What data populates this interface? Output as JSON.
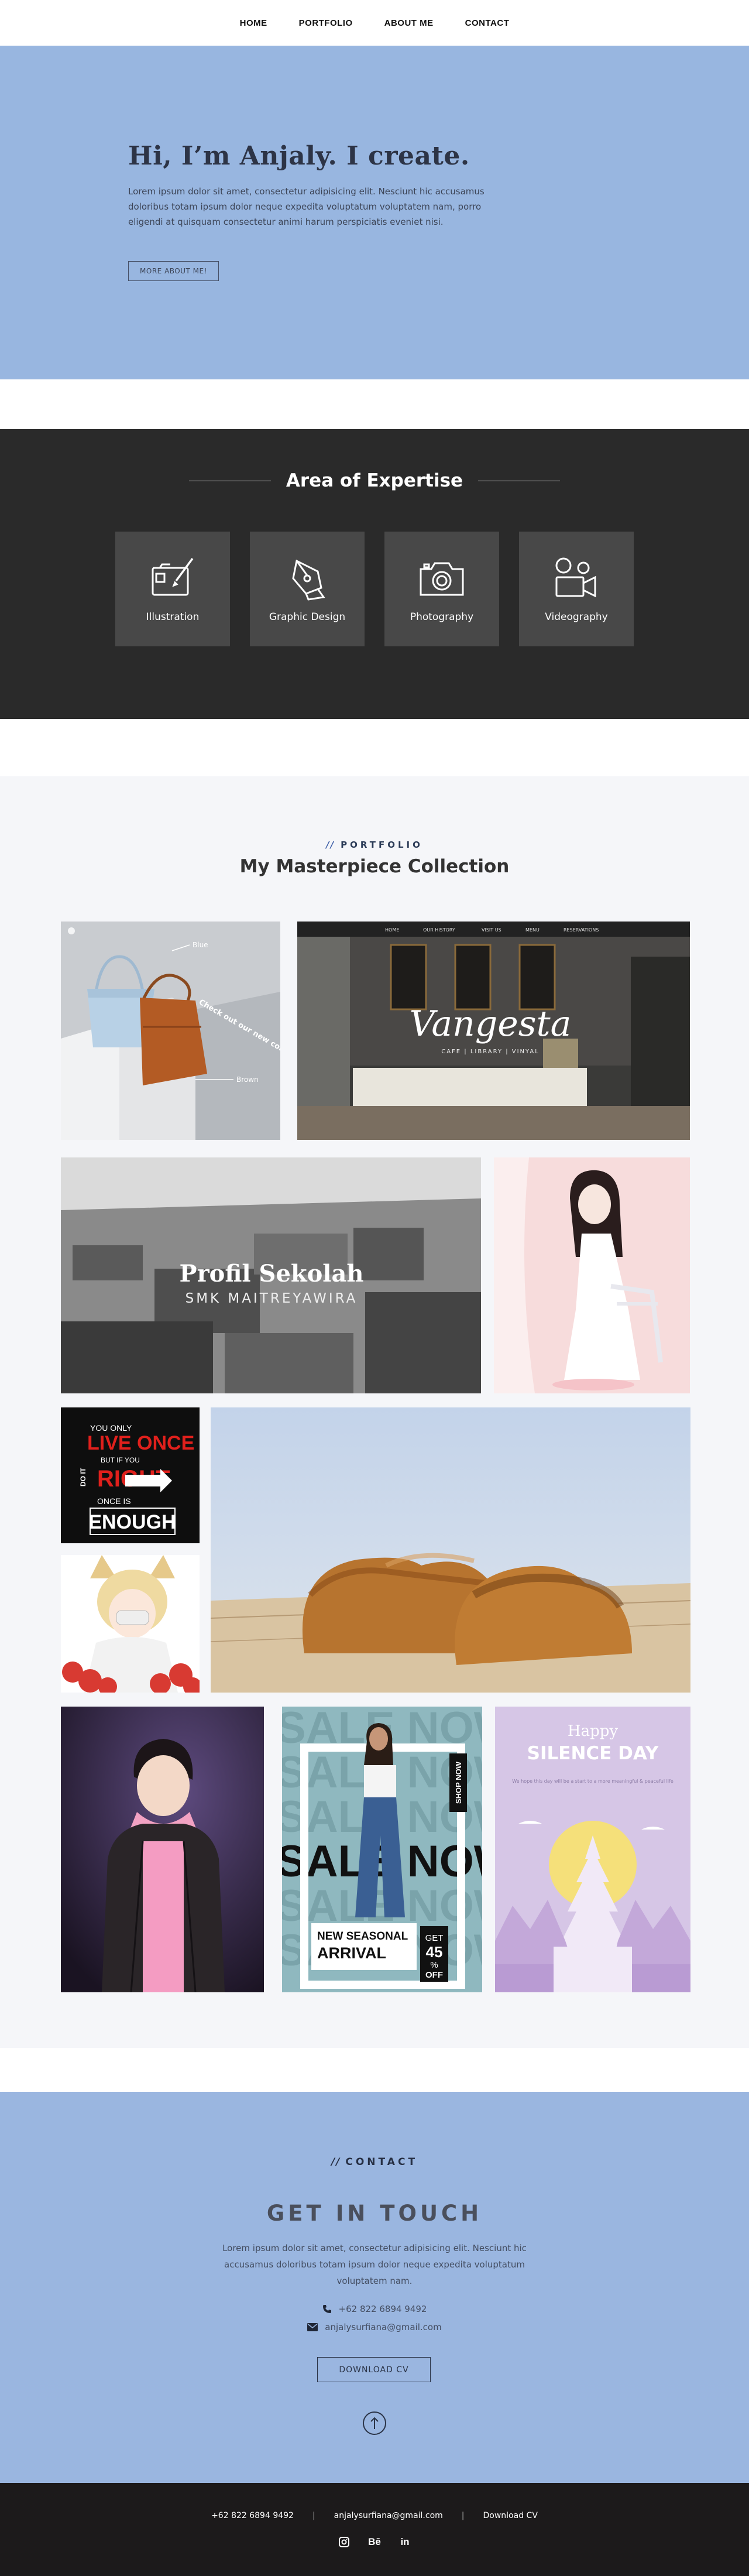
{
  "nav": {
    "items": [
      {
        "label": "HOME"
      },
      {
        "label": "PORTFOLIO"
      },
      {
        "label": "ABOUT ME"
      },
      {
        "label": "CONTACT"
      }
    ]
  },
  "hero": {
    "title": "Hi, I’m Anjaly. I create.",
    "text": "Lorem ipsum dolor sit amet, consectetur adipisicing elit. Nesciunt hic accusamus doloribus totam ipsum dolor neque expedita voluptatum voluptatem nam, porro eligendi at quisquam consectetur animi harum perspiciatis eveniet nisi.",
    "button": "MORE ABOUT ME!"
  },
  "expertise": {
    "title": "Area of Expertise",
    "cards": [
      {
        "label": "Illustration",
        "icon": "illustration-icon"
      },
      {
        "label": "Graphic Design",
        "icon": "pen-tool-icon"
      },
      {
        "label": "Photography",
        "icon": "camera-icon"
      },
      {
        "label": "Videography",
        "icon": "video-camera-icon"
      }
    ]
  },
  "portfolio": {
    "kicker_slash": "//",
    "kicker": "PORTFOLIO",
    "title": "My Masterpiece Collection",
    "tiles": {
      "bag_blue": "Blue",
      "bag_check": "Check out our new colour!",
      "bag_brown": "Brown",
      "cafe_nav": [
        "HOME",
        "OUR HISTORY",
        "VISIT US",
        "MENU",
        "RESERVATIONS"
      ],
      "cafe_logo": "Vangesta",
      "cafe_tag": "CAFE | LIBRARY | VINYAL",
      "school_title": "Profil Sekolah",
      "school_sub": "SMK MAITREYAWIRA",
      "poster_l1": "YOU ONLY",
      "poster_l2": "LIVE ONCE",
      "poster_l3": "BUT IF YOU",
      "poster_l4": "DO IT",
      "poster_l5": "RIGHT",
      "poster_l6": "ONCE IS",
      "poster_l7": "ENOUGH",
      "sale_word": "SALE NOW",
      "sale_shop": "SHOP NOW",
      "sale_new": "NEW SEASONAL",
      "sale_arrival": "ARRIVAL",
      "sale_get": "GET",
      "sale_pct": "45",
      "sale_pct_sign": "%",
      "sale_off": "OFF",
      "silence_happy": "Happy",
      "silence_day": "SILENCE DAY",
      "silence_text": "We hope this day will be a start to a more meaningful & peaceful life"
    }
  },
  "contact": {
    "kicker_slash": "//",
    "kicker": "CONTACT",
    "title": "GET IN TOUCH",
    "text": "Lorem ipsum dolor sit amet, consectetur adipisicing elit. Nesciunt hic accusamus doloribus totam ipsum dolor neque expedita voluptatum voluptatem nam.",
    "phone": "+62 822 6894 9492",
    "email": "anjalysurfiana@gmail.com",
    "button": "DOWNLOAD CV"
  },
  "footer": {
    "phone": "+62 822 6894 9492",
    "email": "anjalysurfiana@gmail.com",
    "cv": "Download CV",
    "sep": "|",
    "icons": [
      "instagram-icon",
      "behance-icon",
      "linkedin-icon"
    ],
    "behance_text": "Bē",
    "linkedin_text": "in"
  },
  "colors": {
    "hero_bg": "#98b6e0",
    "expertise_bg": "#2a2a2a",
    "card_bg": "#484848",
    "portfolio_bg": "#f5f6f9",
    "contact_bg": "#9ab6e0",
    "footer_bg": "#1c1a1b"
  }
}
